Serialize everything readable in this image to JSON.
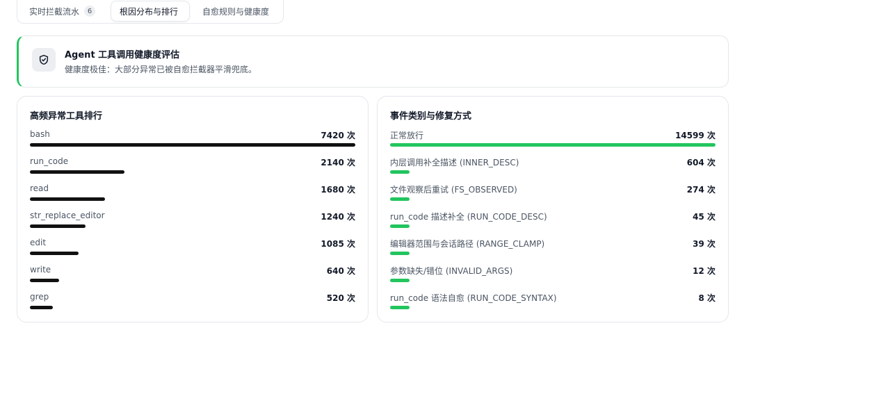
{
  "tabs": [
    {
      "label": "实时拦截流水",
      "count": "6"
    },
    {
      "label": "根因分布与排行"
    },
    {
      "label": "自愈规则与健康度"
    }
  ],
  "health": {
    "title": "Agent 工具调用健康度评估",
    "description": "健康度极佳：大部分异常已被自愈拦截器平滑兜底。",
    "icon": "shield-check-icon",
    "accent": "#22c55e"
  },
  "tool_ranking": {
    "title": "高频异常工具排行",
    "bar_color": "#111111",
    "items": [
      {
        "name": "bash",
        "count_label": "7420 次",
        "fraction": 1.0
      },
      {
        "name": "run_code",
        "count_label": "2140 次",
        "fraction": 0.29
      },
      {
        "name": "read",
        "count_label": "1680 次",
        "fraction": 0.23
      },
      {
        "name": "str_replace_editor",
        "count_label": "1240 次",
        "fraction": 0.17
      },
      {
        "name": "edit",
        "count_label": "1085 次",
        "fraction": 0.15
      },
      {
        "name": "write",
        "count_label": "640 次",
        "fraction": 0.09
      },
      {
        "name": "grep",
        "count_label": "520 次",
        "fraction": 0.07
      }
    ]
  },
  "event_categories": {
    "title": "事件类别与修复方式",
    "bar_color": "#22c55e",
    "items": [
      {
        "name": "正常放行",
        "count_label": "14599 次",
        "fraction": 1.0
      },
      {
        "name": "内层调用补全描述 (INNER_DESC)",
        "count_label": "604 次",
        "fraction": 0.06
      },
      {
        "name": "文件观察后重试 (FS_OBSERVED)",
        "count_label": "274 次",
        "fraction": 0.06
      },
      {
        "name": "run_code 描述补全 (RUN_CODE_DESC)",
        "count_label": "45 次",
        "fraction": 0.06
      },
      {
        "name": "编辑器范围与会话路径 (RANGE_CLAMP)",
        "count_label": "39 次",
        "fraction": 0.06
      },
      {
        "name": "参数缺失/错位 (INVALID_ARGS)",
        "count_label": "12 次",
        "fraction": 0.06
      },
      {
        "name": "run_code 语法自愈 (RUN_CODE_SYNTAX)",
        "count_label": "8 次",
        "fraction": 0.06
      }
    ]
  }
}
